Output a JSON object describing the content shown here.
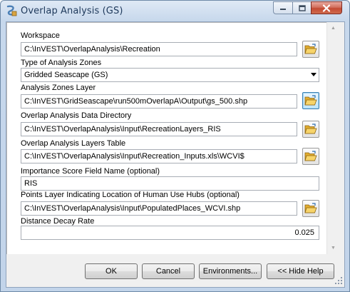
{
  "window": {
    "title": "Overlap Analysis (GS)"
  },
  "title_controls": {
    "minimize_icon": "minimize-icon",
    "maximize_icon": "maximize-icon",
    "close_icon": "close-icon"
  },
  "form": {
    "workspace": {
      "label": "Workspace",
      "value": "C:\\InVEST\\OverlapAnalysis\\Recreation"
    },
    "analysis_zones_type": {
      "label": "Type of Analysis Zones",
      "value": "Gridded Seascape (GS)"
    },
    "analysis_zones_layer": {
      "label": "Analysis Zones Layer",
      "value": "C:\\InVEST\\GridSeascape\\run500mOverlapA\\Output\\gs_500.shp"
    },
    "data_directory": {
      "label": "Overlap Analysis Data Directory",
      "value": "C:\\InVEST\\OverlapAnalysis\\Input\\RecreationLayers_RIS"
    },
    "layers_table": {
      "label": "Overlap Analysis Layers Table",
      "value": "C:\\InVEST\\OverlapAnalysis\\Input\\Recreation_Inputs.xls\\WCVI$"
    },
    "importance_field": {
      "label": "Importance Score Field Name (optional)",
      "value": "RIS"
    },
    "hubs_layer": {
      "label": "Points Layer Indicating Location of Human Use Hubs (optional)",
      "value": "C:\\InVEST\\OverlapAnalysis\\Input\\PopulatedPlaces_WCVI.shp"
    },
    "distance_decay": {
      "label": "Distance Decay Rate",
      "value": "0.025"
    }
  },
  "buttons": {
    "ok": "OK",
    "cancel": "Cancel",
    "environments": "Environments...",
    "hide_help": "<< Hide Help"
  },
  "colors": {
    "folder": "#e7b83a",
    "accent": "#3c7fb1"
  }
}
